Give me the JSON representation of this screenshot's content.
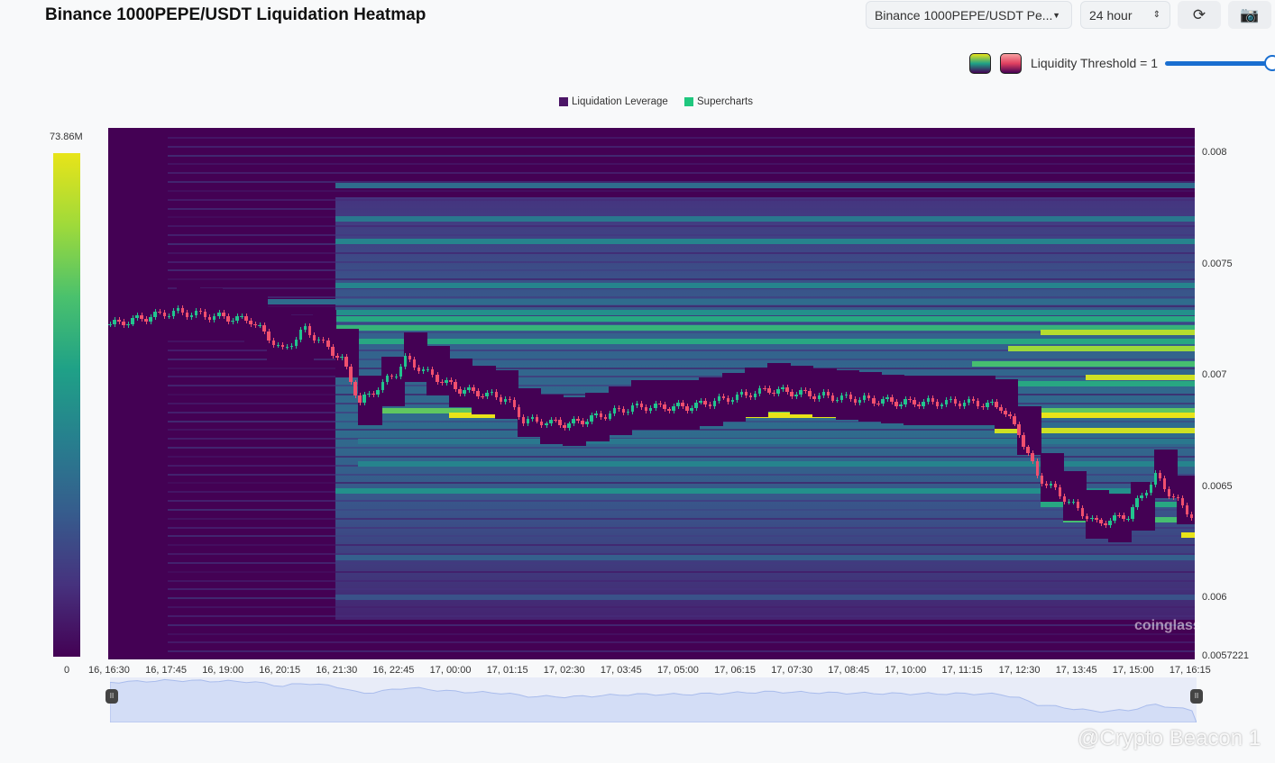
{
  "header": {
    "title": "Binance 1000PEPE/USDT Liquidation Heatmap",
    "pair_select": "Binance 1000PEPE/USDT Pe...",
    "range_select": "24 hour",
    "refresh_icon": "refresh-icon",
    "camera_icon": "camera-icon"
  },
  "threshold": {
    "label": "Liquidity Threshold = 1",
    "value": 1
  },
  "watermark": "coinglass",
  "credit": "@Crypto Beacon 1",
  "chart_data": {
    "type": "heatmap",
    "title": "Binance 1000PEPE/USDT Liquidation Heatmap",
    "legend": [
      {
        "name": "Liquidation Leverage",
        "color": "#4b1566"
      },
      {
        "name": "Supercharts",
        "color": "#1fc77e"
      }
    ],
    "colorbar": {
      "max_label": "73.86M",
      "min_label": "0",
      "max": 73.86,
      "min": 0
    },
    "y_ticks": [
      "0.008",
      "0.0075",
      "0.007",
      "0.0065",
      "0.006",
      "0.0057221"
    ],
    "y_tick_values": [
      0.008,
      0.0075,
      0.007,
      0.0065,
      0.006,
      0.0057221
    ],
    "ylim": [
      0.0057221,
      0.00811
    ],
    "xlim_hours": [
      0,
      23.9
    ],
    "x_ticks": [
      "16, 16:30",
      "16, 17:45",
      "16, 19:00",
      "16, 20:15",
      "16, 21:30",
      "16, 22:45",
      "17, 00:00",
      "17, 01:15",
      "17, 02:30",
      "17, 03:45",
      "17, 05:00",
      "17, 06:15",
      "17, 07:30",
      "17, 08:45",
      "17, 10:00",
      "17, 11:15",
      "17, 12:30",
      "17, 13:45",
      "17, 15:00",
      "17, 16:15"
    ],
    "price_path": [
      [
        0,
        0.007226
      ],
      [
        1.4,
        0.007284
      ],
      [
        3.1,
        0.007245
      ],
      [
        3.8,
        0.007109
      ],
      [
        4.3,
        0.007206
      ],
      [
        5.1,
        0.00707
      ],
      [
        5.5,
        0.006876
      ],
      [
        6.3,
        0.007012
      ],
      [
        6.5,
        0.00707
      ],
      [
        7.3,
        0.006973
      ],
      [
        7.7,
        0.006934
      ],
      [
        8.7,
        0.006895
      ],
      [
        9.1,
        0.006798
      ],
      [
        10.1,
        0.006778
      ],
      [
        11.5,
        0.006856
      ],
      [
        12.7,
        0.006856
      ],
      [
        14.5,
        0.006934
      ],
      [
        15.8,
        0.006903
      ],
      [
        17.4,
        0.006876
      ],
      [
        19.0,
        0.006876
      ],
      [
        19.6,
        0.006856
      ],
      [
        20.0,
        0.00674
      ],
      [
        20.4,
        0.006545
      ],
      [
        21.0,
        0.006447
      ],
      [
        21.7,
        0.006331
      ],
      [
        22.4,
        0.00637
      ],
      [
        23.0,
        0.006545
      ],
      [
        23.4,
        0.006447
      ],
      [
        23.9,
        0.00635
      ]
    ],
    "bands": [
      {
        "price": 0.00733,
        "start": 1.3,
        "level": 0.35
      },
      {
        "price": 0.00728,
        "start": 5,
        "level": 0.5
      },
      {
        "price": 0.00725,
        "start": 5,
        "level": 0.6
      },
      {
        "price": 0.00721,
        "start": 5,
        "level": 0.65
      },
      {
        "price": 0.00719,
        "start": 20.5,
        "level": 0.9
      },
      {
        "price": 0.00715,
        "start": 5,
        "level": 0.6
      },
      {
        "price": 0.00712,
        "start": 19.8,
        "level": 0.85
      },
      {
        "price": 0.00705,
        "start": 19,
        "level": 0.7
      },
      {
        "price": 0.00699,
        "start": 21.5,
        "level": 0.95
      },
      {
        "price": 0.00696,
        "start": 19.5,
        "level": 0.6
      },
      {
        "price": 0.00684,
        "start": 5.7,
        "level": 0.75
      },
      {
        "price": 0.00682,
        "start": 7.5,
        "level": 1.0
      },
      {
        "price": 0.00675,
        "start": 19.5,
        "level": 0.95
      },
      {
        "price": 0.0067,
        "start": 5.5,
        "level": 0.4
      },
      {
        "price": 0.0066,
        "start": 5.5,
        "level": 0.45
      },
      {
        "price": 0.00648,
        "start": 5,
        "level": 0.5
      },
      {
        "price": 0.00642,
        "start": 20.5,
        "level": 0.6
      },
      {
        "price": 0.00635,
        "start": 21,
        "level": 0.7
      },
      {
        "price": 0.00628,
        "start": 23.6,
        "level": 1.0
      },
      {
        "price": 0.00785,
        "start": 5,
        "level": 0.35
      },
      {
        "price": 0.0077,
        "start": 5,
        "level": 0.4
      },
      {
        "price": 0.0076,
        "start": 5,
        "level": 0.45
      },
      {
        "price": 0.0074,
        "start": 5,
        "level": 0.45
      },
      {
        "price": 0.00618,
        "start": 5,
        "level": 0.3
      },
      {
        "price": 0.006,
        "start": 5,
        "level": 0.25
      }
    ]
  }
}
